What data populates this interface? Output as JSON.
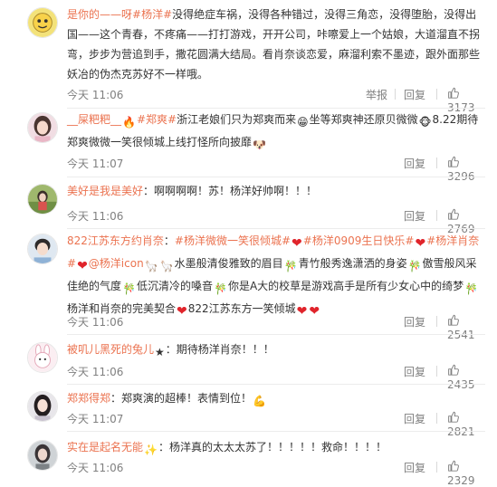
{
  "comments": [
    {
      "username": "是你的——呀",
      "body": [
        {
          "t": "tag",
          "v": "#杨洋#"
        },
        {
          "t": "text",
          "v": "没得绝症车祸，没得各种错过，没得三角恋，没得堕胎，没得出国——这个青春，不疼痛——打打游戏，开开公司，咔嚓爱上一个姑娘，大道溜直不拐弯，步步为营追到手，撒花圆满大结局。看肖奈谈恋爱，麻溜利索不墨迹，跟外面那些妖冶的伪杰克苏好不一样哦。"
        }
      ],
      "time": "今天 11:06",
      "report": "举报",
      "reply": "回复",
      "likes": "3173",
      "avatar": "yellow-cartoon"
    },
    {
      "username": "__屎粑粑__",
      "body": [
        {
          "t": "icon",
          "name": "fire-emoji-icon",
          "v": "🔥"
        },
        {
          "t": "tag",
          "v": "#郑爽#"
        },
        {
          "t": "text",
          "v": "浙江老娘们只为郑爽而来"
        },
        {
          "t": "icon",
          "name": "grin-face-icon",
          "v": "😁"
        },
        {
          "t": "text",
          "v": "坐等郑爽神还原贝微微"
        },
        {
          "t": "icon",
          "name": "monkey-face-icon",
          "v": "🐵"
        },
        {
          "t": "text",
          "v": "8.22期待郑爽微微一笑很倾城上线打怪所向披靡"
        },
        {
          "t": "icon",
          "name": "doge-face-icon",
          "v": "🐶"
        }
      ],
      "time": "今天 11:07",
      "report": "",
      "reply": "回复",
      "likes": "3296",
      "avatar": "girl-pink"
    },
    {
      "username": "美好是我是美好",
      "body": [
        {
          "t": "text",
          "v": "：啊啊啊啊！苏！杨洋好帅啊！！！"
        }
      ],
      "time": "今天 11:06",
      "report": "",
      "reply": "回复",
      "likes": "2769",
      "avatar": "girl-green"
    },
    {
      "username": "822江苏东方约肖奈",
      "body": [
        {
          "t": "text",
          "v": "："
        },
        {
          "t": "tag",
          "v": "#杨洋微微一笑很倾城#"
        },
        {
          "t": "icon",
          "name": "heart-icon",
          "v": "❤"
        },
        {
          "t": "tag",
          "v": "#杨洋0909生日快乐#"
        },
        {
          "t": "icon",
          "name": "heart-icon",
          "v": "❤"
        },
        {
          "t": "tag",
          "v": "#杨洋肖奈#"
        },
        {
          "t": "icon",
          "name": "heart-icon",
          "v": "❤"
        },
        {
          "t": "tag",
          "v": "@杨洋icon"
        },
        {
          "t": "icon",
          "name": "alpaca-icon",
          "v": "🦙"
        },
        {
          "t": "icon",
          "name": "alpaca-icon",
          "v": "🦙"
        },
        {
          "t": "text",
          "v": "水墨般清俊雅致的眉目"
        },
        {
          "t": "icon",
          "name": "bamboo-icon",
          "v": "🎋"
        },
        {
          "t": "text",
          "v": "青竹般秀逸潇洒的身姿"
        },
        {
          "t": "icon",
          "name": "bamboo-icon",
          "v": "🎋"
        },
        {
          "t": "text",
          "v": "傲雪般风采佳绝的气度"
        },
        {
          "t": "icon",
          "name": "bamboo-icon",
          "v": "🎋"
        },
        {
          "t": "text",
          "v": "低沉清冷的嗓音"
        },
        {
          "t": "icon",
          "name": "bamboo-icon",
          "v": "🎋"
        },
        {
          "t": "text",
          "v": "你是A大的校草是游戏高手是所有少女心中的绮梦"
        },
        {
          "t": "icon",
          "name": "bamboo-icon",
          "v": "🎋"
        },
        {
          "t": "text",
          "v": "杨洋和肖奈的完美契合"
        },
        {
          "t": "icon",
          "name": "heart-icon",
          "v": "❤"
        },
        {
          "t": "text",
          "v": "822江苏东方一笑倾城"
        },
        {
          "t": "icon",
          "name": "heart-icon",
          "v": "❤"
        },
        {
          "t": "icon",
          "name": "heart-icon",
          "v": "❤"
        }
      ],
      "time": "今天 11:06",
      "report": "",
      "reply": "回复",
      "likes": "2541",
      "avatar": "boy-blue"
    },
    {
      "username": "被叽儿黑死的兔儿",
      "body": [
        {
          "t": "icon",
          "name": "star-icon",
          "v": "★"
        },
        {
          "t": "text",
          "v": "：期待杨洋肖奈！！！"
        }
      ],
      "time": "今天 11:06",
      "report": "",
      "reply": "回复",
      "likes": "2435",
      "avatar": "bunny"
    },
    {
      "username": "郑郑得郑",
      "body": [
        {
          "t": "text",
          "v": "：郑爽演的超棒！表情到位！"
        },
        {
          "t": "icon",
          "name": "muscle-icon",
          "v": "💪"
        }
      ],
      "time": "今天 11:07",
      "report": "",
      "reply": "回复",
      "likes": "2821",
      "avatar": "girl-dark"
    },
    {
      "username": "实在是起名无能",
      "body": [
        {
          "t": "icon",
          "name": "sparkle-icon",
          "v": "✨"
        },
        {
          "t": "text",
          "v": "：杨洋真的太太太苏了！！！！！救命！！！！"
        }
      ],
      "time": "今天 11:06",
      "report": "",
      "reply": "回复",
      "likes": "2329",
      "avatar": "girl-gray"
    }
  ]
}
